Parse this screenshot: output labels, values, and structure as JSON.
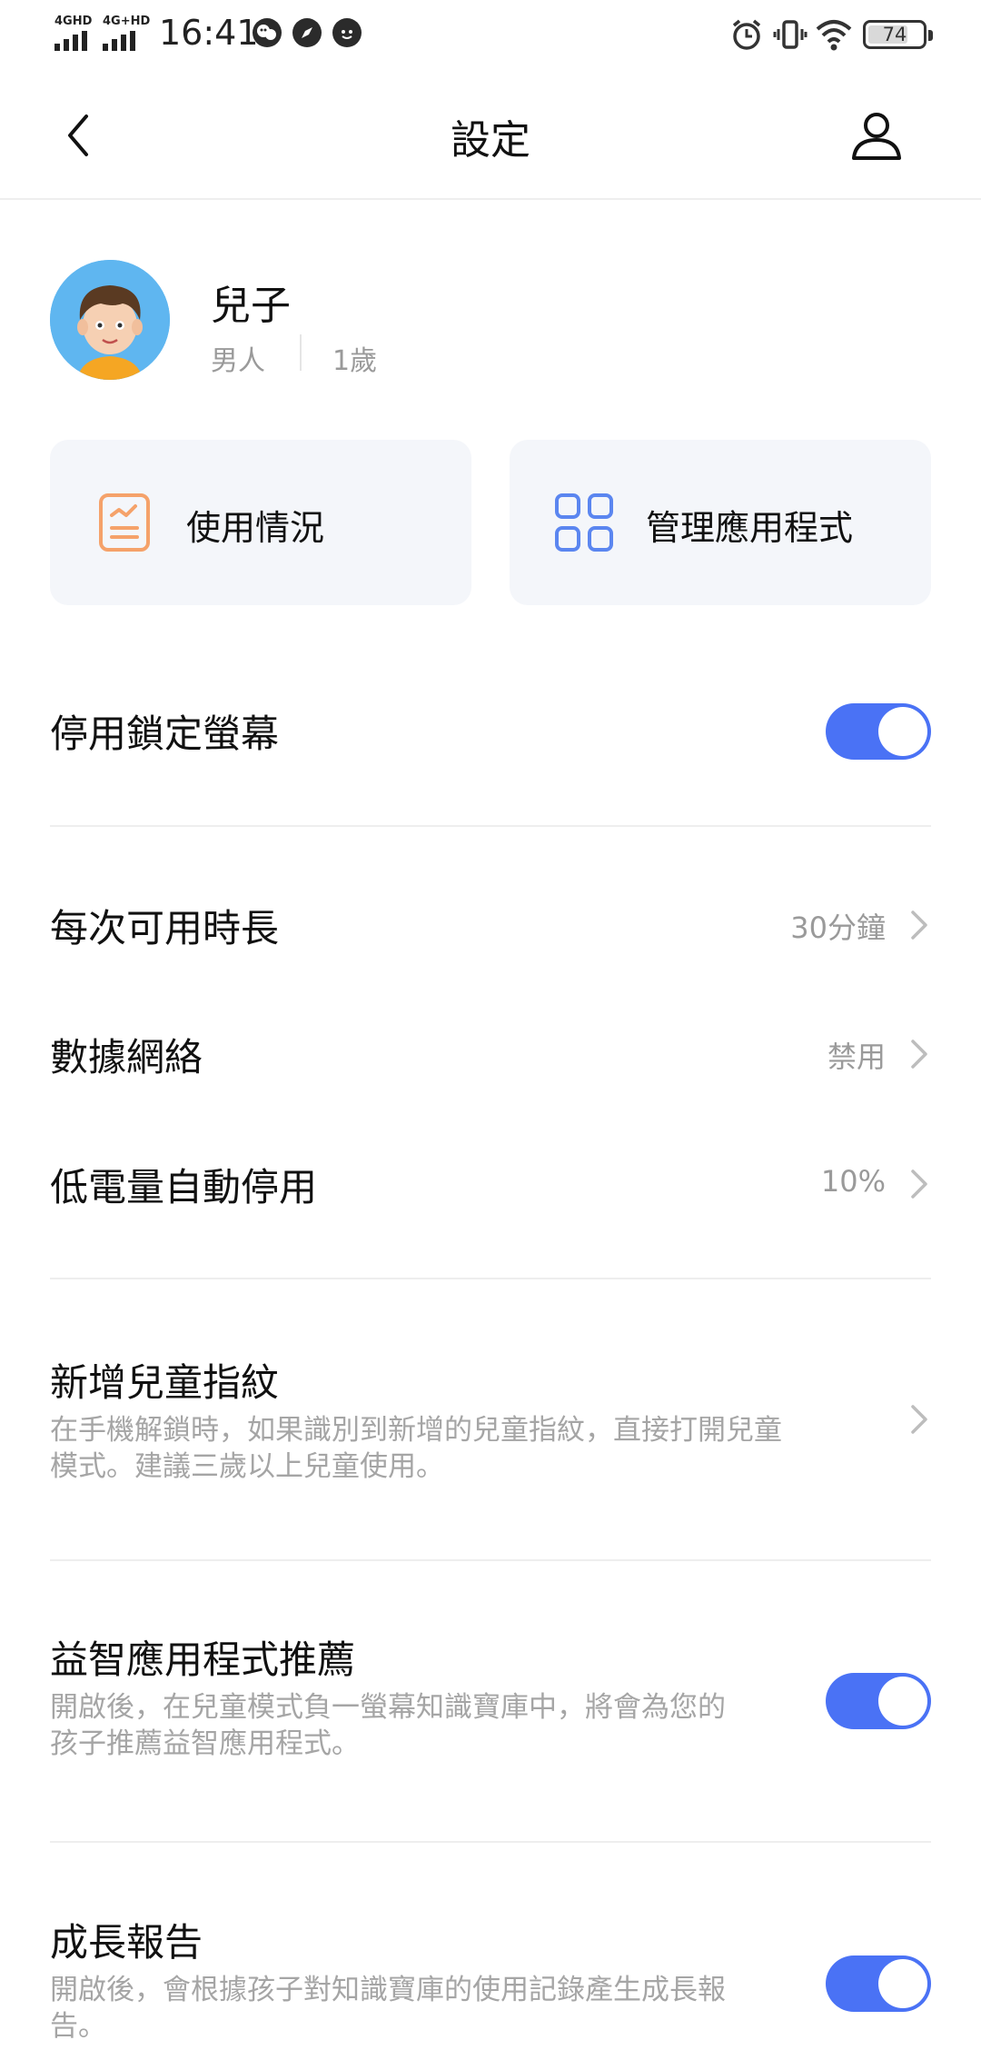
{
  "status_bar": {
    "network_1": "4GHD",
    "network_2": "4G+HD",
    "time": "16:41",
    "battery": "74",
    "battery_level_percent": 74,
    "icons": [
      "wechat-icon",
      "compass-icon",
      "kid-face-icon",
      "alarm-icon",
      "vibrate-icon",
      "wifi-icon",
      "battery-icon"
    ]
  },
  "header": {
    "title": "設定"
  },
  "child": {
    "name": "兒子",
    "gender": "男人",
    "age": "1歲"
  },
  "shortcuts": {
    "usage": "使用情況",
    "manage_apps": "管理應用程式"
  },
  "settings": {
    "disable_lock_screen": {
      "label": "停用鎖定螢幕",
      "enabled": true
    },
    "time_per_use": {
      "label": "每次可用時長",
      "value": "30分鐘"
    },
    "mobile_data": {
      "label": "數據網絡",
      "value": "禁用"
    },
    "low_battery": {
      "label": "低電量自動停用",
      "value": "10%"
    },
    "fingerprint": {
      "label": "新增兒童指紋",
      "desc_line1": "在手機解鎖時，如果識別到新增的兒童指紋，直接打開兒童",
      "desc_line2": "模式。建議三歲以上兒童使用。"
    },
    "app_recommend": {
      "label": "益智應用程式推薦",
      "enabled": true,
      "desc_line1": "開啟後，在兒童模式負一螢幕知識寶庫中，將會為您的",
      "desc_line2": "孩子推薦益智應用程式。"
    },
    "growth_report": {
      "label": "成長報告",
      "enabled": true,
      "desc_line1": "開啟後，會根據孩子對知識寶庫的使用記錄產生成長報",
      "desc_line2": "告。"
    }
  },
  "colors": {
    "accent": "#4a72f5",
    "usage_icon": "#f5a26a",
    "apps_icon": "#5b86f0",
    "card_bg": "#f4f6fa"
  }
}
